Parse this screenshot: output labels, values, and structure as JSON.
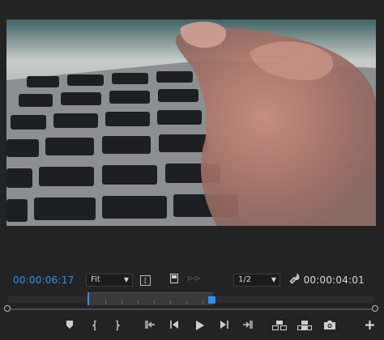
{
  "monitor": {
    "current_timecode": "00:00:06:17",
    "duration_timecode": "00:00:04:01",
    "zoom_select": {
      "value": "Fit"
    },
    "resolution_select": {
      "value": "1/2"
    }
  },
  "icons": {
    "mark_box": "[",
    "fx": "⊳⊳",
    "wrench": "🔧"
  },
  "transport": [
    "add-marker",
    "mark-in",
    "mark-out",
    "go-to-in",
    "step-back",
    "play",
    "step-forward",
    "go-to-out",
    "insert",
    "overwrite",
    "export-frame",
    "add-button"
  ],
  "colors": {
    "accent": "#2f8ff5",
    "background": "#232323"
  }
}
